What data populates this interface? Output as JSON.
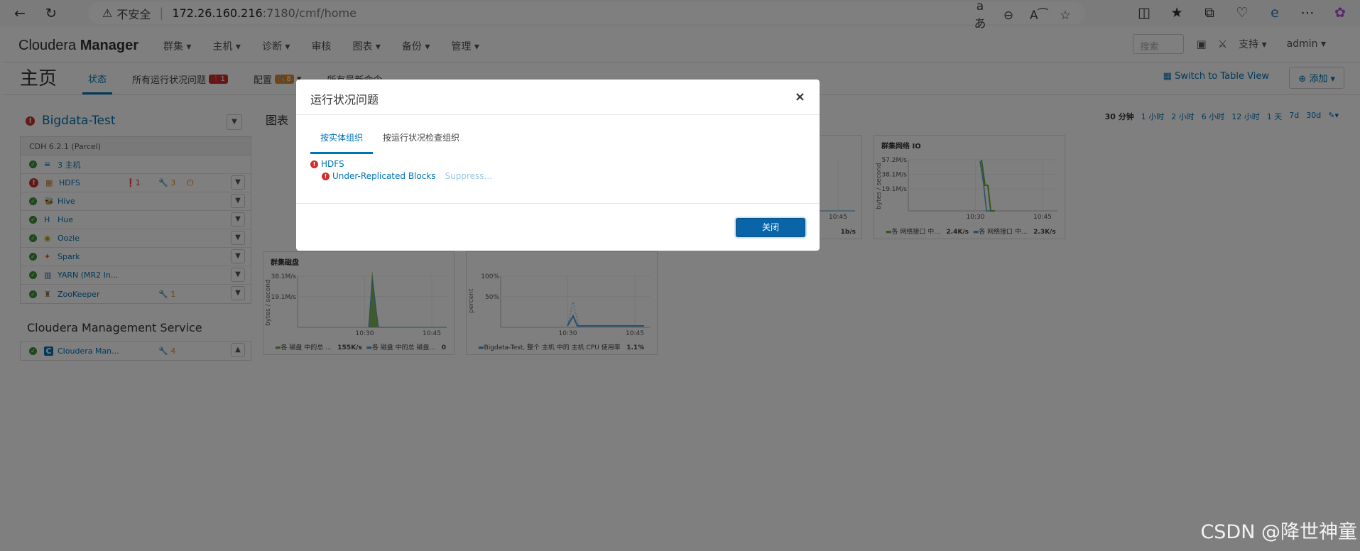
{
  "browser": {
    "insecure_label": "不安全",
    "url_host": "172.26.160.216",
    "url_path": ":7180/cmf/home"
  },
  "nav": {
    "logo_light": "Cloudera",
    "logo_bold": "Manager",
    "menus": [
      "群集 ▾",
      "主机 ▾",
      "诊断 ▾",
      "审核",
      "图表 ▾",
      "备份 ▾",
      "管理 ▾"
    ],
    "search_placeholder": "搜索",
    "support": "支持 ▾",
    "user": "admin ▾"
  },
  "subbar": {
    "title": "主页",
    "tabs": {
      "status": "状态",
      "health_issues": "所有运行状况问题",
      "health_count": "1",
      "config": "配置",
      "config_count": "8",
      "commands": "所有最新命令"
    },
    "table_view": "Switch to Table View",
    "add": "添加 ▾"
  },
  "cluster": {
    "name": "Bigdata-Test",
    "version": "CDH 6.2.1 (Parcel)",
    "services": [
      {
        "name": "3 主机",
        "status": "ok",
        "logo": "≡",
        "logo_color": "#0073b2"
      },
      {
        "name": "HDFS",
        "status": "error",
        "logo": "▦",
        "logo_color": "#c77e35",
        "err": "1",
        "cfg": "3",
        "restart": "⏻"
      },
      {
        "name": "Hive",
        "status": "ok",
        "logo": "🐝",
        "logo_color": "#d6a400"
      },
      {
        "name": "Hue",
        "status": "ok",
        "logo": "H",
        "logo_color": "#0073b2"
      },
      {
        "name": "Oozie",
        "status": "ok",
        "logo": "◉",
        "logo_color": "#b2a400"
      },
      {
        "name": "Spark",
        "status": "ok",
        "logo": "✦",
        "logo_color": "#e25a1c"
      },
      {
        "name": "YARN (MR2 In...",
        "status": "ok",
        "logo": "▥",
        "logo_color": "#2d6ba5"
      },
      {
        "name": "ZooKeeper",
        "status": "ok",
        "logo": "♜",
        "logo_color": "#8a6d3b",
        "cfg": "1"
      }
    ]
  },
  "mgmt": {
    "title": "Cloudera Management Service",
    "service": {
      "name": "Cloudera Man...",
      "status": "ok",
      "logo": "C",
      "cfg": "4"
    }
  },
  "charts_section": {
    "title": "图表",
    "time_ranges": [
      "30 分钟",
      "1 小时",
      "2 小时",
      "6 小时",
      "12 小时",
      "1 天",
      "7d",
      "30d"
    ],
    "selected": "30 分钟"
  },
  "chart_data": [
    {
      "type": "line",
      "title": "群集网络 IO",
      "ylabel": "bytes / second",
      "y_ticks": [
        "57.2M/s",
        "38.1M/s",
        "19.1M/s"
      ],
      "x_ticks": [
        "10:30",
        "10:45"
      ],
      "series": [
        {
          "name": "各 网络接口 中...",
          "value": "2.4K/s",
          "color": "#6aaa3a"
        },
        {
          "name": "各 网络接口 中...",
          "value": "2.3K/s",
          "color": "#4b9fd5"
        }
      ]
    },
    {
      "type": "area",
      "title": "群集磁盘",
      "ylabel": "bytes / second",
      "y_ticks": [
        "38.1M/s",
        "19.1M/s"
      ],
      "x_ticks": [
        "10:30",
        "10:45"
      ],
      "series": [
        {
          "name": "各 磁盘 中的总 ...",
          "value": "155K/s",
          "color": "#6aaa3a"
        },
        {
          "name": "各 磁盘 中的总 磁盘...",
          "value": "0",
          "color": "#4b9fd5"
        }
      ]
    },
    {
      "type": "line",
      "title": "",
      "ylabel": "percent",
      "y_ticks": [
        "100%",
        "50%"
      ],
      "x_ticks": [
        "10:30",
        "10:45"
      ],
      "series": [
        {
          "name": "Bigdata-Test, 整个 主机 中的 主机 CPU 使用率",
          "value": "1.1%",
          "color": "#4b9fd5"
        }
      ]
    },
    {
      "type": "line",
      "title": "",
      "x_ticks": [
        "10:45"
      ],
      "series": [
        {
          "name": "",
          "value": "1b/s",
          "color": "#4b9fd5"
        }
      ]
    }
  ],
  "modal": {
    "title": "运行状况问题",
    "close_x": "×",
    "tabs": [
      "按实体组织",
      "按运行状况检查组织"
    ],
    "entity": "HDFS",
    "issue": "Under-Replicated Blocks",
    "suppress": "Suppress...",
    "close_button": "关闭"
  },
  "watermark": "CSDN @降世神童"
}
